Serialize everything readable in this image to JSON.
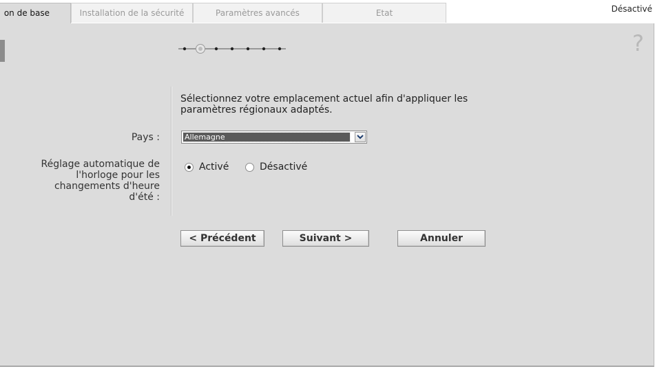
{
  "tabs": [
    {
      "label": "on de base",
      "active": true
    },
    {
      "label": "Installation de la sécurité",
      "active": false
    },
    {
      "label": "Paramètres avancés",
      "active": false
    },
    {
      "label": "Etat",
      "active": false
    }
  ],
  "header": {
    "status": "Désactivé"
  },
  "help": {
    "symbol": "?"
  },
  "wizard": {
    "total_steps": 7,
    "current_step": 2,
    "intro": "Sélectionnez votre emplacement actuel afin d'appliquer les paramètres régionaux adaptés.",
    "country_label": "Pays :",
    "country_value": "Allemagne",
    "dst_label": "Réglage automatique de l'horloge pour les changements d'heure d'été :",
    "dst_options": [
      {
        "label": "Activé",
        "checked": true
      },
      {
        "label": "Désactivé",
        "checked": false
      }
    ]
  },
  "buttons": {
    "previous": "< Précédent",
    "next": "Suivant >",
    "cancel": "Annuler"
  },
  "colors": {
    "panel": "#dcdcdc",
    "tab_inactive": "#f2f2f2",
    "progress_inactive": "#bdbdbd",
    "progress_active": "#222222"
  }
}
